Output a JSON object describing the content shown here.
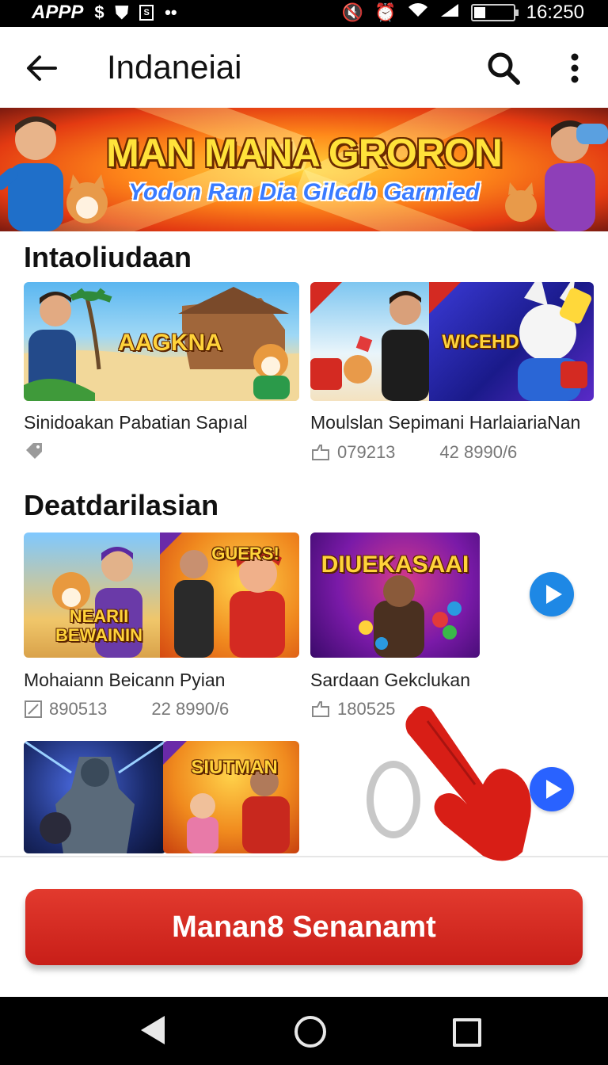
{
  "status_bar": {
    "app_label": "APPP",
    "time": "16:250",
    "icons": [
      "dollar-icon",
      "shield-icon",
      "sim-icon",
      "dots-icon",
      "mute-icon",
      "alarm-icon",
      "wifi-icon",
      "signal-icon",
      "battery-icon"
    ]
  },
  "app_bar": {
    "title": "Indaneiai",
    "icons": [
      "back-arrow-icon",
      "search-icon",
      "more-vert-icon"
    ]
  },
  "banner": {
    "title": "MAN MANA GRORON",
    "subtitle": "Yodon Ran Dia Gilcdb Garmied"
  },
  "sections": [
    {
      "title": "Intaoliudaan",
      "cards": [
        {
          "thumb_text": "AAGKNA",
          "title": "Sinidoakan Pabatian Sapıal",
          "meta": []
        },
        {
          "thumb_text": "WICEHD",
          "title": "Moulslan Sepimani HarlaiariaNan",
          "meta": [
            "079213",
            "42 8990/6"
          ]
        }
      ]
    },
    {
      "title": "Deatdarilasian",
      "cards": [
        {
          "thumb_text": "NEARII BEWAININ",
          "thumb_text2": "GUERS!",
          "title": "Mohaiann Beicann Pyian",
          "meta": [
            "890513",
            "22 8990/6"
          ]
        },
        {
          "thumb_text": "DIUEKASAAI",
          "title": "Sardaan Gekclukan",
          "meta": [
            "180525"
          ]
        },
        {
          "thumb_text": "",
          "title": "",
          "meta": []
        },
        {
          "thumb_text": "SIUTMAN",
          "title": "",
          "meta": []
        }
      ]
    }
  ],
  "cta": {
    "label": "Manan8 Senanamt"
  },
  "colors": {
    "accent_red": "#d42a22",
    "play_blue": "#1e88e5",
    "play_blue2": "#2962ff"
  }
}
